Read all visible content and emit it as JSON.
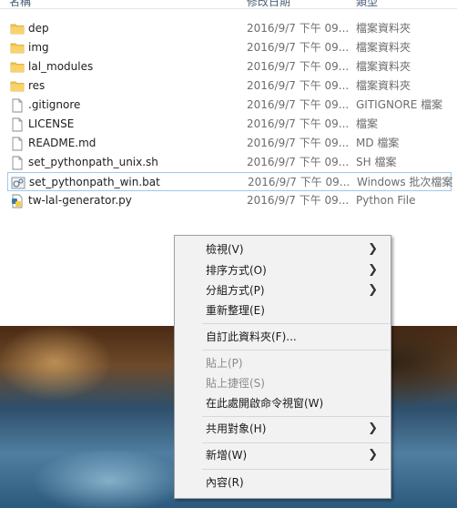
{
  "header": {
    "name": "名稱",
    "date": "修改日期",
    "type": "類型"
  },
  "files": [
    {
      "name": "dep",
      "date": "2016/9/7 下午 09...",
      "type": "檔案資料夾",
      "icon": "folder-icon"
    },
    {
      "name": "img",
      "date": "2016/9/7 下午 09...",
      "type": "檔案資料夾",
      "icon": "folder-icon"
    },
    {
      "name": "lal_modules",
      "date": "2016/9/7 下午 09...",
      "type": "檔案資料夾",
      "icon": "folder-icon"
    },
    {
      "name": "res",
      "date": "2016/9/7 下午 09...",
      "type": "檔案資料夾",
      "icon": "folder-icon"
    },
    {
      "name": ".gitignore",
      "date": "2016/9/7 下午 09...",
      "type": "GITIGNORE 檔案",
      "icon": "file-icon"
    },
    {
      "name": "LICENSE",
      "date": "2016/9/7 下午 09...",
      "type": "檔案",
      "icon": "file-icon"
    },
    {
      "name": "README.md",
      "date": "2016/9/7 下午 09...",
      "type": "MD 檔案",
      "icon": "file-icon"
    },
    {
      "name": "set_pythonpath_unix.sh",
      "date": "2016/9/7 下午 09...",
      "type": "SH 檔案",
      "icon": "file-icon"
    },
    {
      "name": "set_pythonpath_win.bat",
      "date": "2016/9/7 下午 09...",
      "type": "Windows 批次檔案",
      "icon": "batch-file-icon"
    },
    {
      "name": "tw-lal-generator.py",
      "date": "2016/9/7 下午 09...",
      "type": "Python File",
      "icon": "python-file-icon"
    }
  ],
  "context_menu": {
    "view": "檢視(V)",
    "sort_by": "排序方式(O)",
    "group_by": "分組方式(P)",
    "refresh": "重新整理(E)",
    "customize_folder": "自訂此資料夾(F)...",
    "paste": "貼上(P)",
    "paste_shortcut": "貼上捷徑(S)",
    "open_command_window": "在此處開啟命令視窗(W)",
    "share_with": "共用對象(H)",
    "new": "新增(W)",
    "properties": "內容(R)"
  },
  "colors": {
    "folder": "#f2c54b",
    "selection_border": "#9ec9f1",
    "menu_bg": "#f2f2f2"
  }
}
